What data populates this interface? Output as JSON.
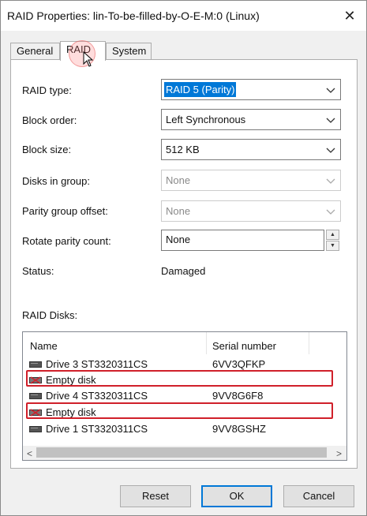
{
  "window": {
    "title": "RAID Properties: lin-To-be-filled-by-O-E-M:0 (Linux)",
    "close_glyph": "✕"
  },
  "tabs": [
    {
      "label": "General"
    },
    {
      "label": "RAID"
    },
    {
      "label": "System"
    }
  ],
  "form": {
    "raid_type": {
      "label": "RAID type:",
      "value": "RAID 5 (Parity)"
    },
    "block_order": {
      "label": "Block order:",
      "value": "Left Synchronous"
    },
    "block_size": {
      "label": "Block size:",
      "value": "512 KB"
    },
    "disks_in_group": {
      "label": "Disks in group:",
      "value": "None"
    },
    "parity_group_offset": {
      "label": "Parity group offset:",
      "value": "None"
    },
    "rotate_parity_count": {
      "label": "Rotate parity count:",
      "value": "None"
    },
    "status": {
      "label": "Status:",
      "value": "Damaged"
    }
  },
  "raid_disks": {
    "label": "RAID Disks:",
    "columns": {
      "name": "Name",
      "serial": "Serial number"
    },
    "rows": [
      {
        "name": "Drive 3 ST3320311CS",
        "serial": "6VV3QFKP",
        "icon": "drive-icon",
        "highlighted": false
      },
      {
        "name": "Empty disk",
        "serial": "",
        "icon": "empty-disk-icon",
        "highlighted": true
      },
      {
        "name": "Drive 4 ST3320311CS",
        "serial": "9VV8G6F8",
        "icon": "drive-icon",
        "highlighted": false
      },
      {
        "name": "Empty disk",
        "serial": "",
        "icon": "empty-disk-icon",
        "highlighted": true
      },
      {
        "name": "Drive 1 ST3320311CS",
        "serial": "9VV8GSHZ",
        "icon": "drive-icon",
        "highlighted": false
      }
    ],
    "scroll_left_glyph": "<",
    "scroll_right_glyph": ">"
  },
  "buttons": {
    "reset": "Reset",
    "ok": "OK",
    "cancel": "Cancel"
  },
  "colors": {
    "selection": "#0078d7",
    "highlight_box": "#d0202a",
    "default_button_border": "#0078d7"
  }
}
